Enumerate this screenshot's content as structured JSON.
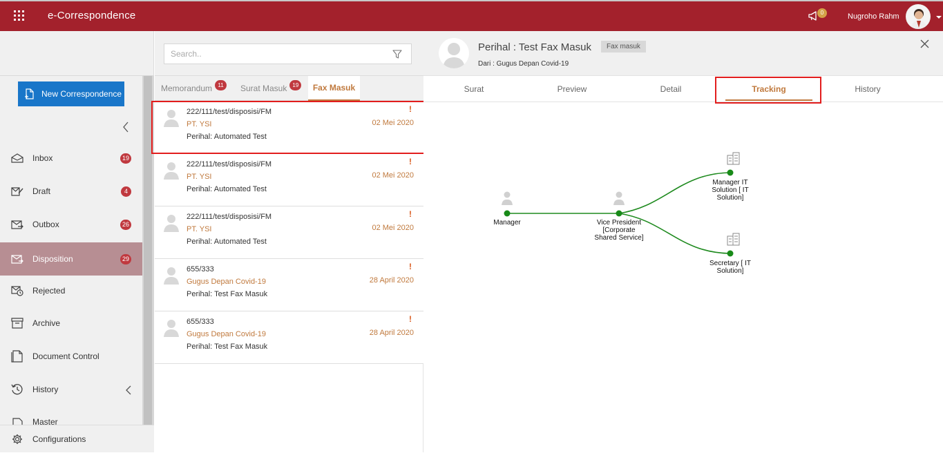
{
  "app": {
    "title": "e-Correspondence"
  },
  "header": {
    "notification_count": "0",
    "user_name": "Nugroho Rahm"
  },
  "sidebar": {
    "new_button": "New Correspondence",
    "items": [
      {
        "label": "Inbox",
        "badge": "19"
      },
      {
        "label": "Draft",
        "badge": "4"
      },
      {
        "label": "Outbox",
        "badge": "26"
      },
      {
        "label": "Disposition",
        "badge": "29"
      },
      {
        "label": "Rejected"
      },
      {
        "label": "Archive"
      },
      {
        "label": "Document Control"
      },
      {
        "label": "History"
      },
      {
        "label": "Master"
      }
    ],
    "configurations": "Configurations"
  },
  "list": {
    "search_placeholder": "Search..",
    "tabs": [
      {
        "label": "Memorandum",
        "badge": "11"
      },
      {
        "label": "Surat Masuk",
        "badge": "19"
      },
      {
        "label": "Fax Masuk"
      }
    ],
    "items": [
      {
        "number": "222/111/test/disposisi/FM",
        "sender": "PT. YSI",
        "subject": "Perihal: Automated Test",
        "date": "02 Mei 2020",
        "flag": "!"
      },
      {
        "number": "222/111/test/disposisi/FM",
        "sender": "PT. YSI",
        "subject": "Perihal: Automated Test",
        "date": "02 Mei 2020",
        "flag": "!"
      },
      {
        "number": "222/111/test/disposisi/FM",
        "sender": "PT. YSI",
        "subject": "Perihal: Automated Test",
        "date": "02 Mei 2020",
        "flag": "!"
      },
      {
        "number": "655/333",
        "sender": "Gugus Depan Covid-19",
        "subject": "Perihal: Test Fax Masuk",
        "date": "28 April 2020",
        "flag": "!"
      },
      {
        "number": "655/333",
        "sender": "Gugus Depan Covid-19",
        "subject": "Perihal: Test Fax Masuk",
        "date": "28 April 2020",
        "flag": "!"
      }
    ]
  },
  "detail": {
    "title": "Perihal : Test Fax Masuk",
    "tag": "Fax masuk",
    "from": "Dari : Gugus Depan Covid-19",
    "tabs": [
      "Surat",
      "Preview",
      "Detail",
      "Tracking",
      "History"
    ],
    "active_tab": "Tracking",
    "tracking": {
      "nodes": [
        {
          "label_lines": [
            "Manager"
          ],
          "icon": "person-icon"
        },
        {
          "label_lines": [
            "Vice President",
            "[Corporate",
            "Shared Service]"
          ],
          "icon": "person-icon"
        },
        {
          "label_lines": [
            "Manager IT",
            "Solution [ IT",
            "Solution]"
          ],
          "icon": "building-icon"
        },
        {
          "label_lines": [
            "Secretary [ IT",
            "Solution]"
          ],
          "icon": "building-icon"
        }
      ],
      "line_color": "#1e8a1e"
    }
  },
  "colors": {
    "brand": "#a3212c",
    "accent": "#c0793d",
    "badge": "#c0393f",
    "primary_button": "#1976c9"
  }
}
